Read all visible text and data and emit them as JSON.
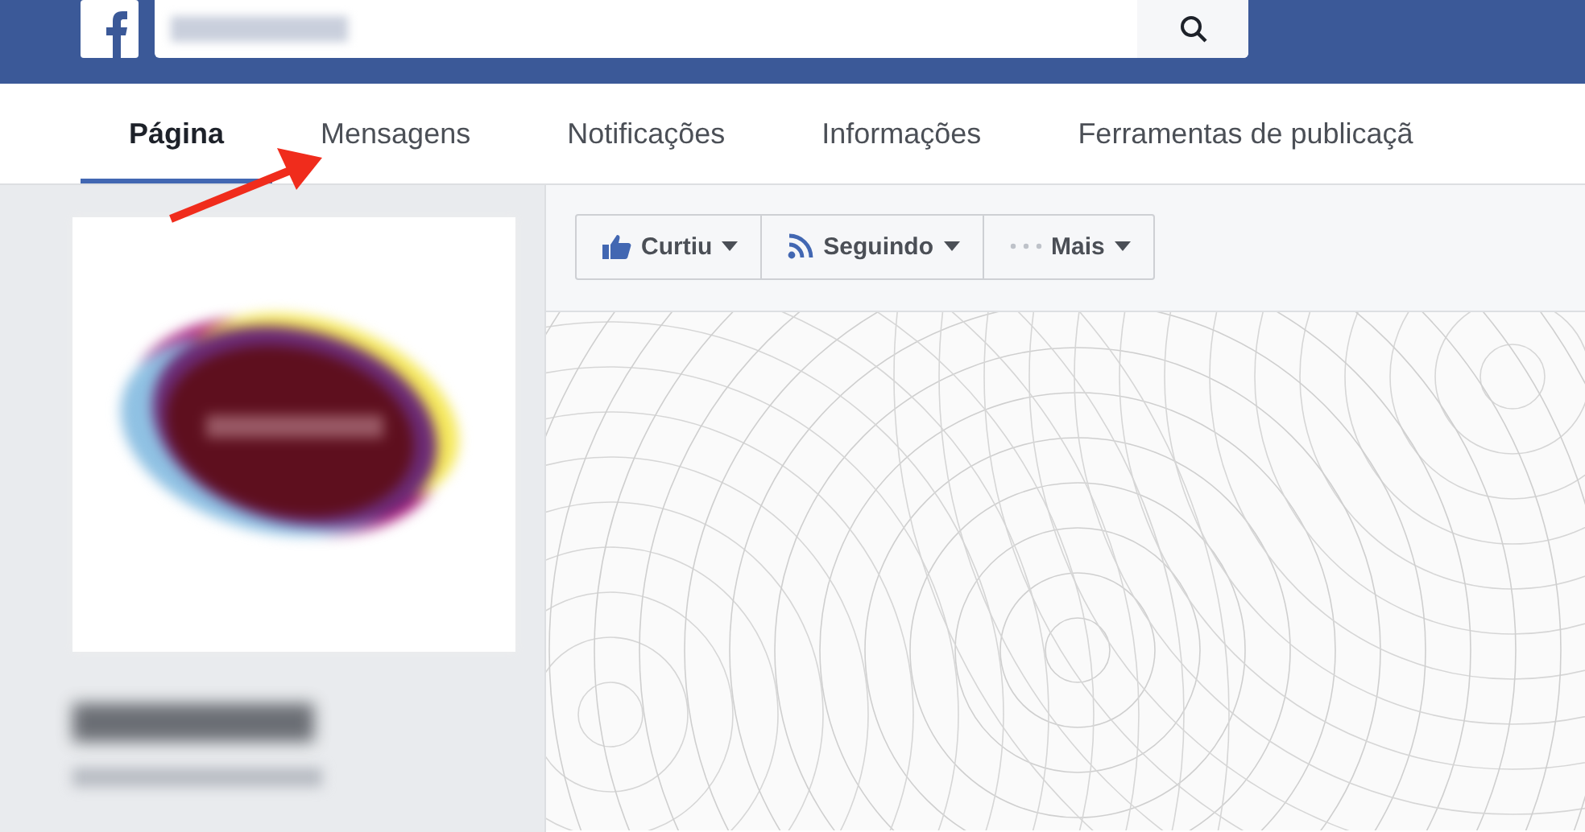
{
  "tabs": [
    {
      "label": "Página",
      "selected": true
    },
    {
      "label": "Mensagens",
      "selected": false
    },
    {
      "label": "Notificações",
      "selected": false
    },
    {
      "label": "Informações",
      "selected": false
    },
    {
      "label": "Ferramentas de publicaçã",
      "selected": false
    }
  ],
  "action_buttons": [
    {
      "label": "Curtiu",
      "kind": "like"
    },
    {
      "label": "Seguindo",
      "kind": "follow"
    },
    {
      "label": "Mais",
      "kind": "more"
    }
  ]
}
